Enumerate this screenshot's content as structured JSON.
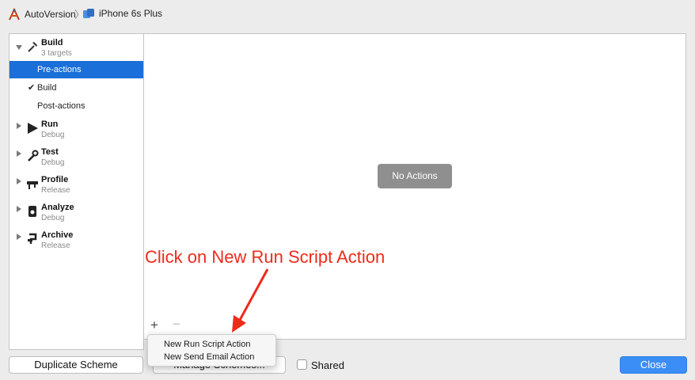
{
  "breadcrumb": {
    "app_name": "AutoVersion",
    "device_name": "iPhone 6s Plus"
  },
  "sidebar": {
    "build": {
      "title": "Build",
      "subtitle": "3 targets"
    },
    "build_items": [
      {
        "label": "Pre-actions",
        "selected": true
      },
      {
        "label": "Build",
        "checked": true
      },
      {
        "label": "Post-actions"
      }
    ],
    "actions": [
      {
        "title": "Run",
        "subtitle": "Debug",
        "icon": "play-icon"
      },
      {
        "title": "Test",
        "subtitle": "Debug",
        "icon": "wrench-icon"
      },
      {
        "title": "Profile",
        "subtitle": "Release",
        "icon": "instruments-icon"
      },
      {
        "title": "Analyze",
        "subtitle": "Debug",
        "icon": "analyze-icon"
      },
      {
        "title": "Archive",
        "subtitle": "Release",
        "icon": "archive-icon"
      }
    ]
  },
  "content": {
    "empty_label": "No Actions",
    "add_symbol": "+",
    "remove_symbol": "−"
  },
  "annotation": {
    "text": "Click on New Run Script Action",
    "color": "#ee2a1b"
  },
  "popup_menu": {
    "items": [
      "New Run Script Action",
      "New Send Email Action"
    ]
  },
  "footer": {
    "duplicate_label": "Duplicate Scheme",
    "manage_label": "Manage Schemes...",
    "shared_label": "Shared",
    "shared_checked": false,
    "close_label": "Close"
  },
  "colors": {
    "selection": "#1b6fd8",
    "close_button": "#3b8ef6"
  }
}
